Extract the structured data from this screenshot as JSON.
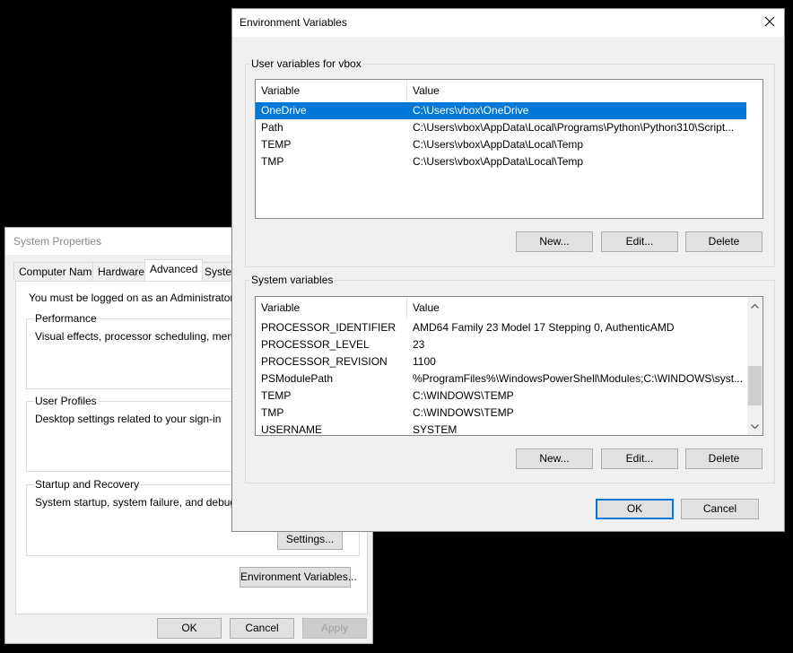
{
  "system_properties": {
    "title": "System Properties",
    "tabs": [
      "Computer Name",
      "Hardware",
      "Advanced",
      "System"
    ],
    "active_tab": "Advanced",
    "admin_note": "You must be logged on as an Administrator to ma",
    "performance": {
      "title": "Performance",
      "description": "Visual effects, processor scheduling, memory u"
    },
    "user_profiles": {
      "title": "User Profiles",
      "description": "Desktop settings related to your sign-in"
    },
    "startup_recovery": {
      "title": "Startup and Recovery",
      "description": "System startup, system failure, and debugging i",
      "settings_label": "Settings..."
    },
    "env_vars_button": "Environment Variables...",
    "ok_label": "OK",
    "cancel_label": "Cancel",
    "apply_label": "Apply"
  },
  "env_vars": {
    "title": "Environment Variables",
    "user_section_label": "User variables for vbox",
    "system_section_label": "System variables",
    "columns": {
      "variable": "Variable",
      "value": "Value"
    },
    "user_vars": [
      {
        "variable": "OneDrive",
        "value": "C:\\Users\\vbox\\OneDrive",
        "selected": true
      },
      {
        "variable": "Path",
        "value": "C:\\Users\\vbox\\AppData\\Local\\Programs\\Python\\Python310\\Script..."
      },
      {
        "variable": "TEMP",
        "value": "C:\\Users\\vbox\\AppData\\Local\\Temp"
      },
      {
        "variable": "TMP",
        "value": "C:\\Users\\vbox\\AppData\\Local\\Temp"
      }
    ],
    "system_vars": [
      {
        "variable": "PROCESSOR_IDENTIFIER",
        "value": "AMD64 Family 23 Model 17 Stepping 0, AuthenticAMD"
      },
      {
        "variable": "PROCESSOR_LEVEL",
        "value": "23"
      },
      {
        "variable": "PROCESSOR_REVISION",
        "value": "1100"
      },
      {
        "variable": "PSModulePath",
        "value": "%ProgramFiles%\\WindowsPowerShell\\Modules;C:\\WINDOWS\\syst..."
      },
      {
        "variable": "TEMP",
        "value": "C:\\WINDOWS\\TEMP"
      },
      {
        "variable": "TMP",
        "value": "C:\\WINDOWS\\TEMP"
      },
      {
        "variable": "USERNAME",
        "value": "SYSTEM"
      }
    ],
    "buttons": {
      "new": "New...",
      "edit": "Edit...",
      "delete": "Delete",
      "ok": "OK",
      "cancel": "Cancel"
    },
    "selection_color": "#0078d7"
  }
}
